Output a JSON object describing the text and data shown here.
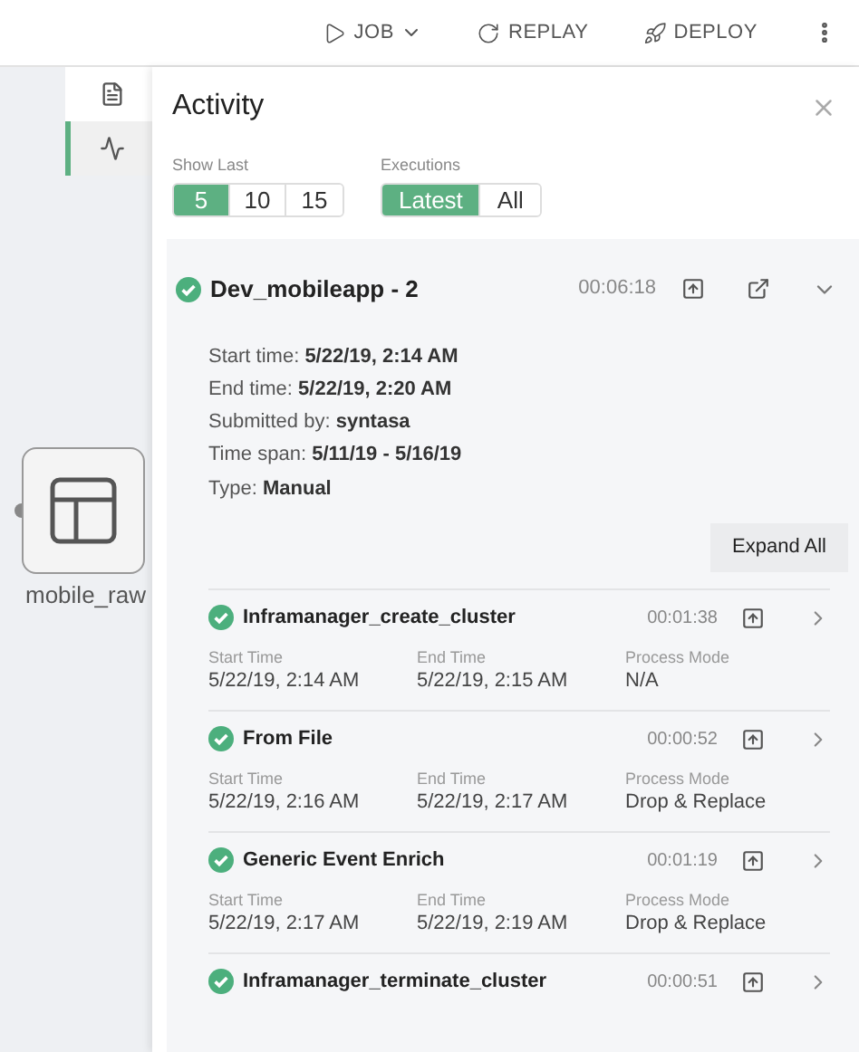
{
  "toolbar": {
    "actions": [
      {
        "kind": "job",
        "label": "JOB"
      },
      {
        "kind": "replay",
        "label": "REPLAY"
      },
      {
        "kind": "deploy",
        "label": "DEPLOY"
      }
    ]
  },
  "side_tabs": [
    {
      "kind": "notes",
      "selected": false
    },
    {
      "kind": "activity",
      "selected": true
    }
  ],
  "canvas": {
    "node": {
      "label": "mobile_raw"
    }
  },
  "activity": {
    "title": "Activity",
    "filters": [
      {
        "label": "Show Last",
        "options": [
          {
            "label": "5",
            "selected": true
          },
          {
            "label": "10",
            "selected": false
          },
          {
            "label": "15",
            "selected": false
          }
        ]
      },
      {
        "label": "Executions",
        "options": [
          {
            "label": "Latest",
            "selected": true
          },
          {
            "label": "All",
            "selected": false
          }
        ]
      }
    ],
    "execution": {
      "name": "Dev_mobileapp - 2",
      "duration": "00:06:18",
      "expanded": true,
      "details": [
        {
          "label": "Start time:",
          "value": "5/22/19, 2:14 AM"
        },
        {
          "label": "End time:",
          "value": "5/22/19, 2:20 AM"
        },
        {
          "label": "Submitted by:",
          "value": "syntasa"
        },
        {
          "label": "Time span:",
          "value": "5/11/19 - 5/16/19"
        },
        {
          "label": "Type:",
          "value": "Manual"
        }
      ],
      "expand_all": "Expand All",
      "steps": [
        {
          "name": "Inframanager_create_cluster",
          "duration": "00:01:38",
          "fields": [
            {
              "label": "Start Time",
              "value": "5/22/19, 2:14 AM"
            },
            {
              "label": "End Time",
              "value": "5/22/19, 2:15 AM"
            },
            {
              "label": "Process Mode",
              "value": "N/A"
            }
          ]
        },
        {
          "name": "From File",
          "duration": "00:00:52",
          "fields": [
            {
              "label": "Start Time",
              "value": "5/22/19, 2:16 AM"
            },
            {
              "label": "End Time",
              "value": "5/22/19, 2:17 AM"
            },
            {
              "label": "Process Mode",
              "value": "Drop & Replace"
            }
          ]
        },
        {
          "name": "Generic Event Enrich",
          "duration": "00:01:19",
          "fields": [
            {
              "label": "Start Time",
              "value": "5/22/19, 2:17 AM"
            },
            {
              "label": "End Time",
              "value": "5/22/19, 2:19 AM"
            },
            {
              "label": "Process Mode",
              "value": "Drop & Replace"
            }
          ]
        },
        {
          "name": "Inframanager_terminate_cluster",
          "duration": "00:00:51"
        }
      ]
    }
  }
}
